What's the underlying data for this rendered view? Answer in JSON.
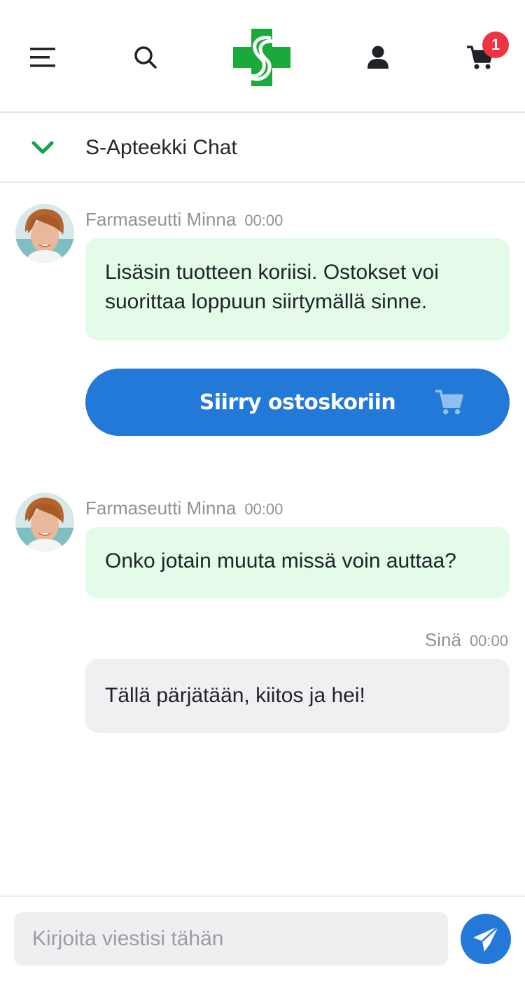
{
  "header": {
    "menu_icon": "hamburger-menu-icon",
    "search_icon": "search-icon",
    "logo_icon": "s-apteekki-logo",
    "user_icon": "user-icon",
    "cart_icon": "cart-icon",
    "cart_count": "1",
    "brand_color": "#1aaa3a",
    "badge_color": "#ef3341"
  },
  "chat": {
    "collapse_icon": "chevron-down-icon",
    "title": "S-Apteekki Chat",
    "accent_color": "#2379d7"
  },
  "messages": [
    {
      "sender": "Farmaseutti Minna",
      "time": "00:00",
      "text": "Lisäsin tuotteen koriisi. Ostokset voi suorittaa loppuun siirtymällä sinne.",
      "action": {
        "label": "Siirry ostoskoriin",
        "icon": "cart-icon"
      }
    },
    {
      "sender": "Farmaseutti Minna",
      "time": "00:00",
      "text": "Onko jotain muuta missä voin auttaa?"
    },
    {
      "sender": "Sinä",
      "time": "00:00",
      "text": "Tällä pärjätään, kiitos ja hei!"
    }
  ],
  "composer": {
    "placeholder": "Kirjoita viestisi tähän",
    "value": "",
    "send_icon": "send-paper-plane-icon"
  }
}
